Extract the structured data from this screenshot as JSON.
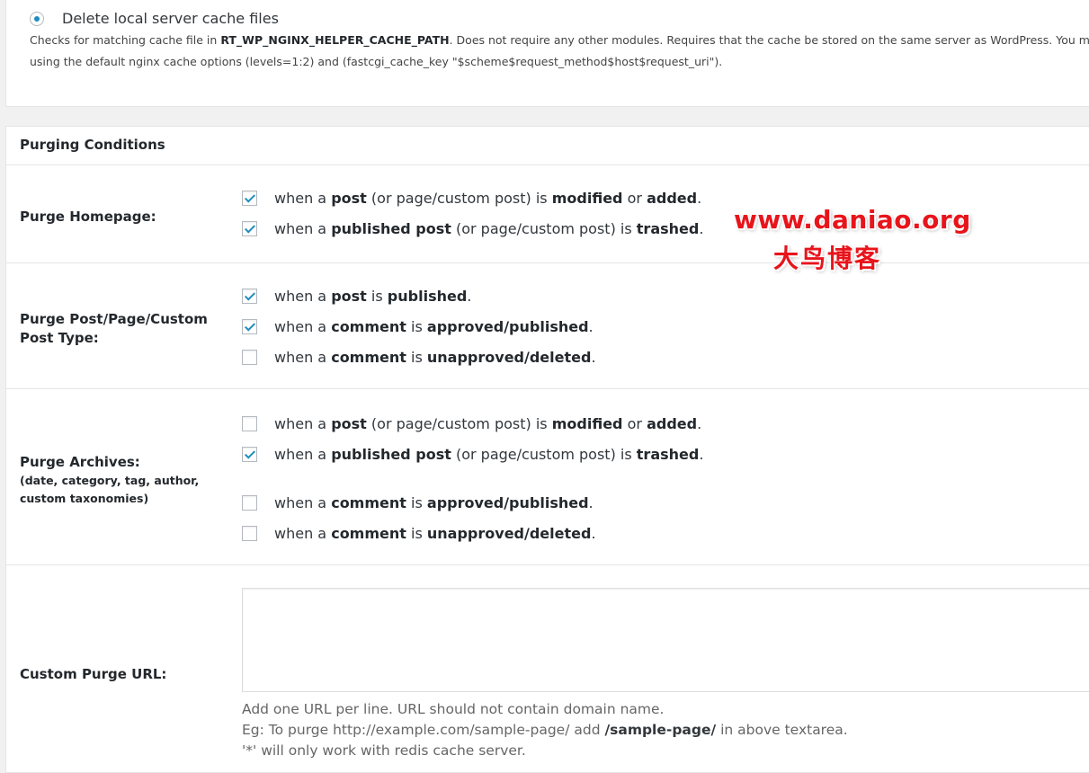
{
  "top": {
    "radio_label": "Delete local server cache files",
    "desc1": {
      "a": "Checks for matching cache file in ",
      "b": "RT_WP_NGINX_HELPER_CACHE_PATH",
      "c": ". Does not require any other modules. Requires that the cache be stored on the same server as WordPress. You mu"
    },
    "desc2": "using the default nginx cache options (levels=1:2) and (fastcgi_cache_key \"$scheme$request_method$host$request_uri\")."
  },
  "section_title": "Purging Conditions",
  "rows": {
    "homepage": {
      "label": "Purge Homepage:"
    },
    "post": {
      "label_line1": "Purge Post/Page/Custom",
      "label_line2": "Post Type:"
    },
    "archives": {
      "label": "Purge Archives:",
      "sub_line1": "(date, category, tag, author,",
      "sub_line2": "custom taxonomies)"
    },
    "custom": {
      "label": "Custom Purge URL:"
    }
  },
  "words": {
    "when_a": "when a",
    "post": "post",
    "page_custom": "(or page/custom post) is",
    "modified": "modified",
    "or": "or",
    "added": "added",
    "published_post": "published post",
    "is": "is",
    "trashed": "trashed",
    "published": "published",
    "comment": "comment",
    "approved_published": "approved/published",
    "unapproved_deleted": "unapproved/deleted",
    "period": "."
  },
  "checkbox_state": {
    "home_modified": true,
    "home_trashed": true,
    "post_published": true,
    "post_comment_approved": true,
    "post_comment_unapproved": false,
    "arch_modified": false,
    "arch_trashed": true,
    "arch_comment_approved": false,
    "arch_comment_unapproved": false
  },
  "help": {
    "line1": "Add one URL per line. URL should not contain domain name.",
    "line2_a": "Eg: To purge http://example.com/sample-page/ add ",
    "line2_b": "/sample-page/",
    "line2_c": " in above textarea.",
    "line3": "'*' will only work with redis cache server."
  },
  "watermark": {
    "url": "www.daniao.org",
    "cn": "大鸟博客",
    "color": "#e8141b"
  },
  "colors": {
    "accent": "#1e8cbe",
    "page_bg": "#f1f1f1"
  }
}
